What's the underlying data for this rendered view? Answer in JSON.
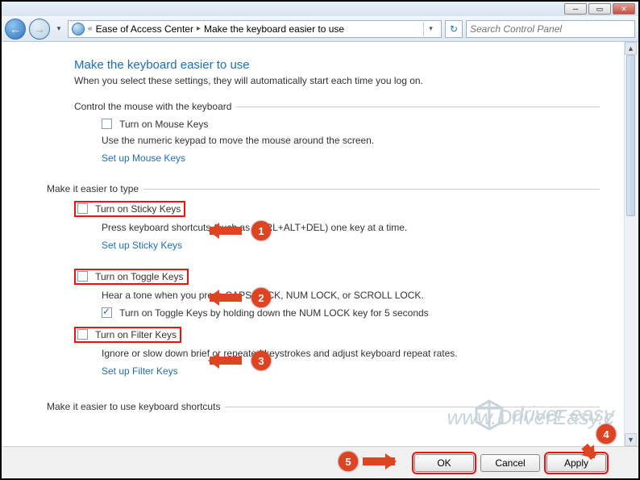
{
  "window": {
    "breadcrumb": {
      "root_icon": "ease-of-access-icon",
      "item1": "Ease of Access Center",
      "item2": "Make the keyboard easier to use"
    },
    "search_placeholder": "Search Control Panel"
  },
  "page": {
    "title": "Make the keyboard easier to use",
    "subtitle": "When you select these settings, they will automatically start each time you log on."
  },
  "sections": {
    "mouse": {
      "label": "Control the mouse with the keyboard",
      "chk_label": "Turn on Mouse Keys",
      "desc": "Use the numeric keypad to move the mouse around the screen.",
      "link": "Set up Mouse Keys"
    },
    "type": {
      "label": "Make it easier to type",
      "sticky": {
        "chk_label": "Turn on Sticky Keys",
        "desc": "Press keyboard shortcuts (such as CTRL+ALT+DEL) one key at a time.",
        "link": "Set up Sticky Keys"
      },
      "toggle": {
        "chk_label": "Turn on Toggle Keys",
        "desc": "Hear a tone when you press CAPS LOCK, NUM LOCK, or SCROLL LOCK.",
        "sub_chk_label": "Turn on Toggle Keys by holding down the NUM LOCK key for 5 seconds"
      },
      "filter": {
        "chk_label": "Turn on Filter Keys",
        "desc": "Ignore or slow down brief or repeated keystrokes and adjust keyboard repeat rates.",
        "link": "Set up Filter Keys"
      }
    },
    "shortcuts": {
      "label": "Make it easier to use keyboard shortcuts"
    }
  },
  "buttons": {
    "ok": "OK",
    "cancel": "Cancel",
    "apply": "Apply"
  },
  "annotations": {
    "b1": "1",
    "b2": "2",
    "b3": "3",
    "b4": "4",
    "b5": "5"
  },
  "watermark": {
    "brand": "driver easy",
    "url": "www.DriverEasy.c"
  }
}
